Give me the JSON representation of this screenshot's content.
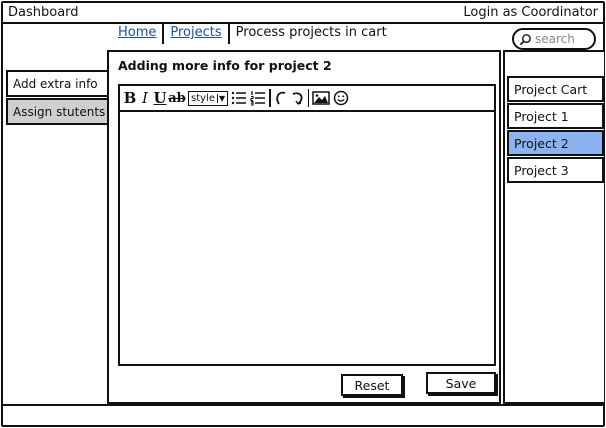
{
  "header": {
    "title": "Dashboard",
    "login_label": "Login as Coordinator"
  },
  "breadcrumb": [
    {
      "label": "Home"
    },
    {
      "label": "Projects"
    },
    {
      "label": "Process projects in cart"
    }
  ],
  "search": {
    "placeholder": "search"
  },
  "left_nav": {
    "items": [
      {
        "label": "Add extra info",
        "selected": true
      },
      {
        "label": "Assign stutents",
        "selected": false
      }
    ]
  },
  "content": {
    "title": "Adding more info for project 2",
    "editor": {
      "style_label": "style",
      "toolbar_icons": [
        "bold-icon",
        "italic-icon",
        "underline-icon",
        "strikethrough-icon",
        "style-dropdown",
        "bullet-list-icon",
        "numbered-list-icon",
        "undo-icon",
        "redo-icon",
        "image-icon",
        "emoji-icon"
      ],
      "text": ""
    },
    "reset_label": "Reset",
    "save_label": "Save"
  },
  "right_panel": {
    "items": [
      {
        "label": "Project Cart"
      },
      {
        "label": "Project 1"
      },
      {
        "label": "Project 2",
        "selected": true
      },
      {
        "label": "Project 3"
      }
    ],
    "accent_color": "#8bb3ef"
  }
}
